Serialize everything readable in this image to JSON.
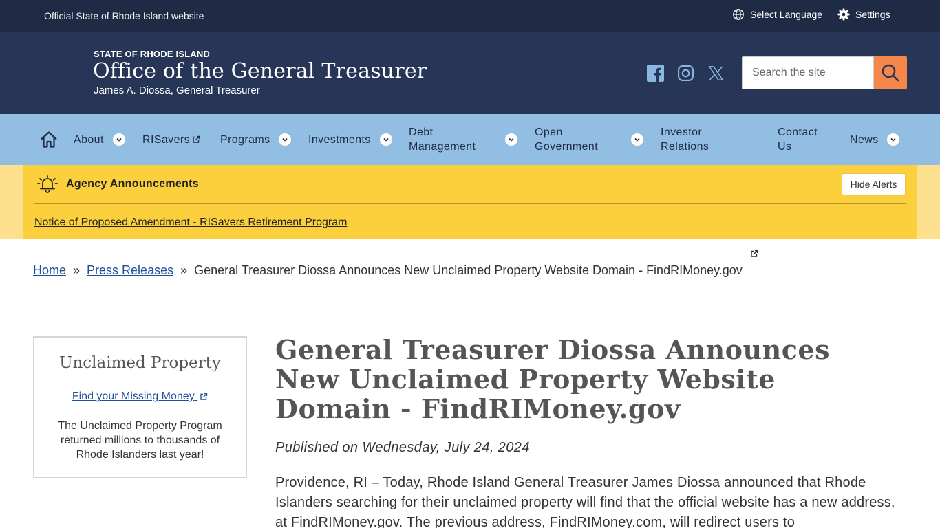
{
  "topbar": {
    "official": "Official State of Rhode Island website",
    "language": "Select Language",
    "settings": "Settings"
  },
  "header": {
    "state": "STATE OF RHODE ISLAND",
    "office": "Office of the General Treasurer",
    "treasurer": "James A. Diossa, General Treasurer",
    "search_placeholder": "Search the site",
    "social": [
      "facebook-icon",
      "instagram-icon",
      "x-icon"
    ]
  },
  "nav": {
    "items": [
      {
        "label": "About"
      },
      {
        "label": "RISavers"
      },
      {
        "label": "Programs"
      },
      {
        "label": "Investments"
      },
      {
        "label1": "Debt",
        "label2": "Management"
      },
      {
        "label1": "Open",
        "label2": "Government"
      },
      {
        "label1": "Investor",
        "label2": "Relations"
      },
      {
        "label1": "Contact",
        "label2": "Us"
      },
      {
        "label": "News"
      }
    ]
  },
  "alerts": {
    "title": "Agency Announcements",
    "hide": "Hide Alerts",
    "notice": "Notice of Proposed Amendment - RISavers Retirement Program"
  },
  "breadcrumb": {
    "home": "Home",
    "press": "Press Releases",
    "sep": "»",
    "current": "General Treasurer Diossa Announces New Unclaimed Property Website Domain - FindRIMoney.gov"
  },
  "card": {
    "title": "Unclaimed Property",
    "link": "Find your Missing Money",
    "text": "The Unclaimed Property Program returned millions to thousands of Rhode Islanders last year!"
  },
  "article": {
    "headline": "General Treasurer Diossa Announces New Unclaimed Property Website Domain - FindRIMoney.gov",
    "published": "Published on Wednesday, July 24, 2024",
    "body": "Providence, RI – Today, Rhode Island General Treasurer James Diossa announced that Rhode Islanders searching for their unclaimed property will find that the official website has a new address, at FindRIMoney.gov. The previous address, FindRIMoney.com, will redirect users to"
  },
  "colors": {
    "topbar": "#1f2a44",
    "header": "#273656",
    "nav": "#93bee3",
    "alert": "#fcd03d",
    "search_button": "#f5874a",
    "link": "#1f4e9a"
  }
}
